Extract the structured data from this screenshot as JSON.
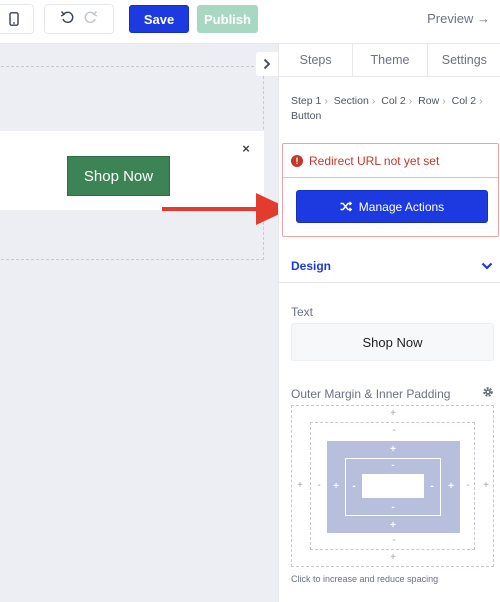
{
  "toolbar": {
    "device_icon": "mobile-icon",
    "undo_icon": "undo-icon",
    "redo_icon": "redo-icon",
    "save_label": "Save",
    "publish_label": "Publish",
    "preview_label": "Preview →"
  },
  "canvas": {
    "button_label": "Shop Now",
    "close_symbol": "×",
    "button_color": "#3c8456",
    "background": "#eceef4"
  },
  "panel": {
    "tabs": [
      {
        "label": "Steps"
      },
      {
        "label": "Theme"
      },
      {
        "label": "Settings"
      }
    ],
    "breadcrumb": [
      "Step 1",
      "Section",
      "Col 2",
      "Row",
      "Col 2",
      "Button"
    ],
    "alert": {
      "icon": "!",
      "message": "Redirect URL not yet set",
      "color": "#c0392b"
    },
    "manage_actions_label": "Manage Actions",
    "design_label": "Design",
    "text_label": "Text",
    "text_value": "Shop Now",
    "spacing_label": "Outer Margin & Inner Padding",
    "spacing_hint": "Click to increase and reduce spacing",
    "accent_color": "#1d3ae0",
    "plus": "+",
    "minus": "-"
  }
}
